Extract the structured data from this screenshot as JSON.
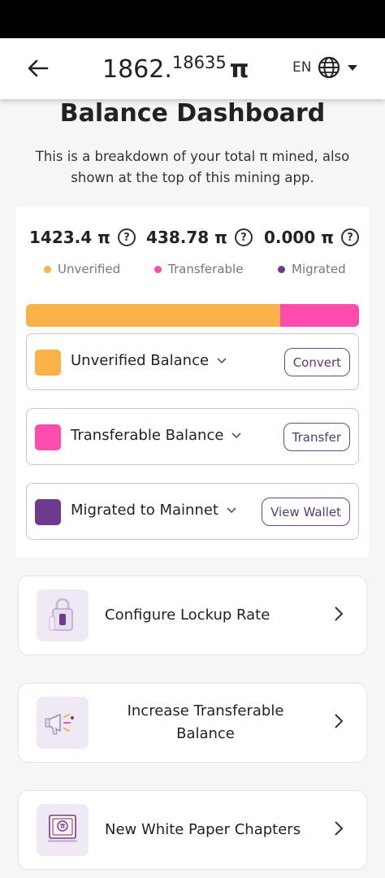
{
  "header": {
    "balance_int": "1862.",
    "balance_frac": "18635",
    "pi_symbol": "π",
    "lang_code": "EN"
  },
  "page": {
    "title": "Balance Dashboard",
    "subtitle": "This is a breakdown of your total π mined, also shown at the top of this mining app."
  },
  "stats": [
    {
      "value": "1423.4 π",
      "label": "Unverified",
      "color": "#f9b24a"
    },
    {
      "value": "438.78 π",
      "label": "Transferable",
      "color": "#fd4cad"
    },
    {
      "value": "0.000 π",
      "label": "Migrated",
      "color": "#6d3a8d"
    }
  ],
  "help_glyph": "?",
  "balance_bar": {
    "unverified_fraction": 0.7644,
    "transferable_fraction": 0.2356,
    "migrated_fraction": 0.0
  },
  "balances": [
    {
      "label": "Unverified Balance",
      "button": "Convert",
      "color": "#f9b24a"
    },
    {
      "label": "Transferable Balance",
      "button": "Transfer",
      "color": "#fd4cad"
    },
    {
      "label": "Migrated to Mainnet",
      "button": "View Wallet",
      "color": "#6d3a8d"
    }
  ],
  "actions": [
    {
      "label": "Configure Lockup Rate",
      "icon": "lock-icon"
    },
    {
      "label": "Increase Transferable Balance",
      "icon": "megaphone-icon"
    },
    {
      "label": "New White Paper Chapters",
      "icon": "whitepaper-icon"
    }
  ]
}
